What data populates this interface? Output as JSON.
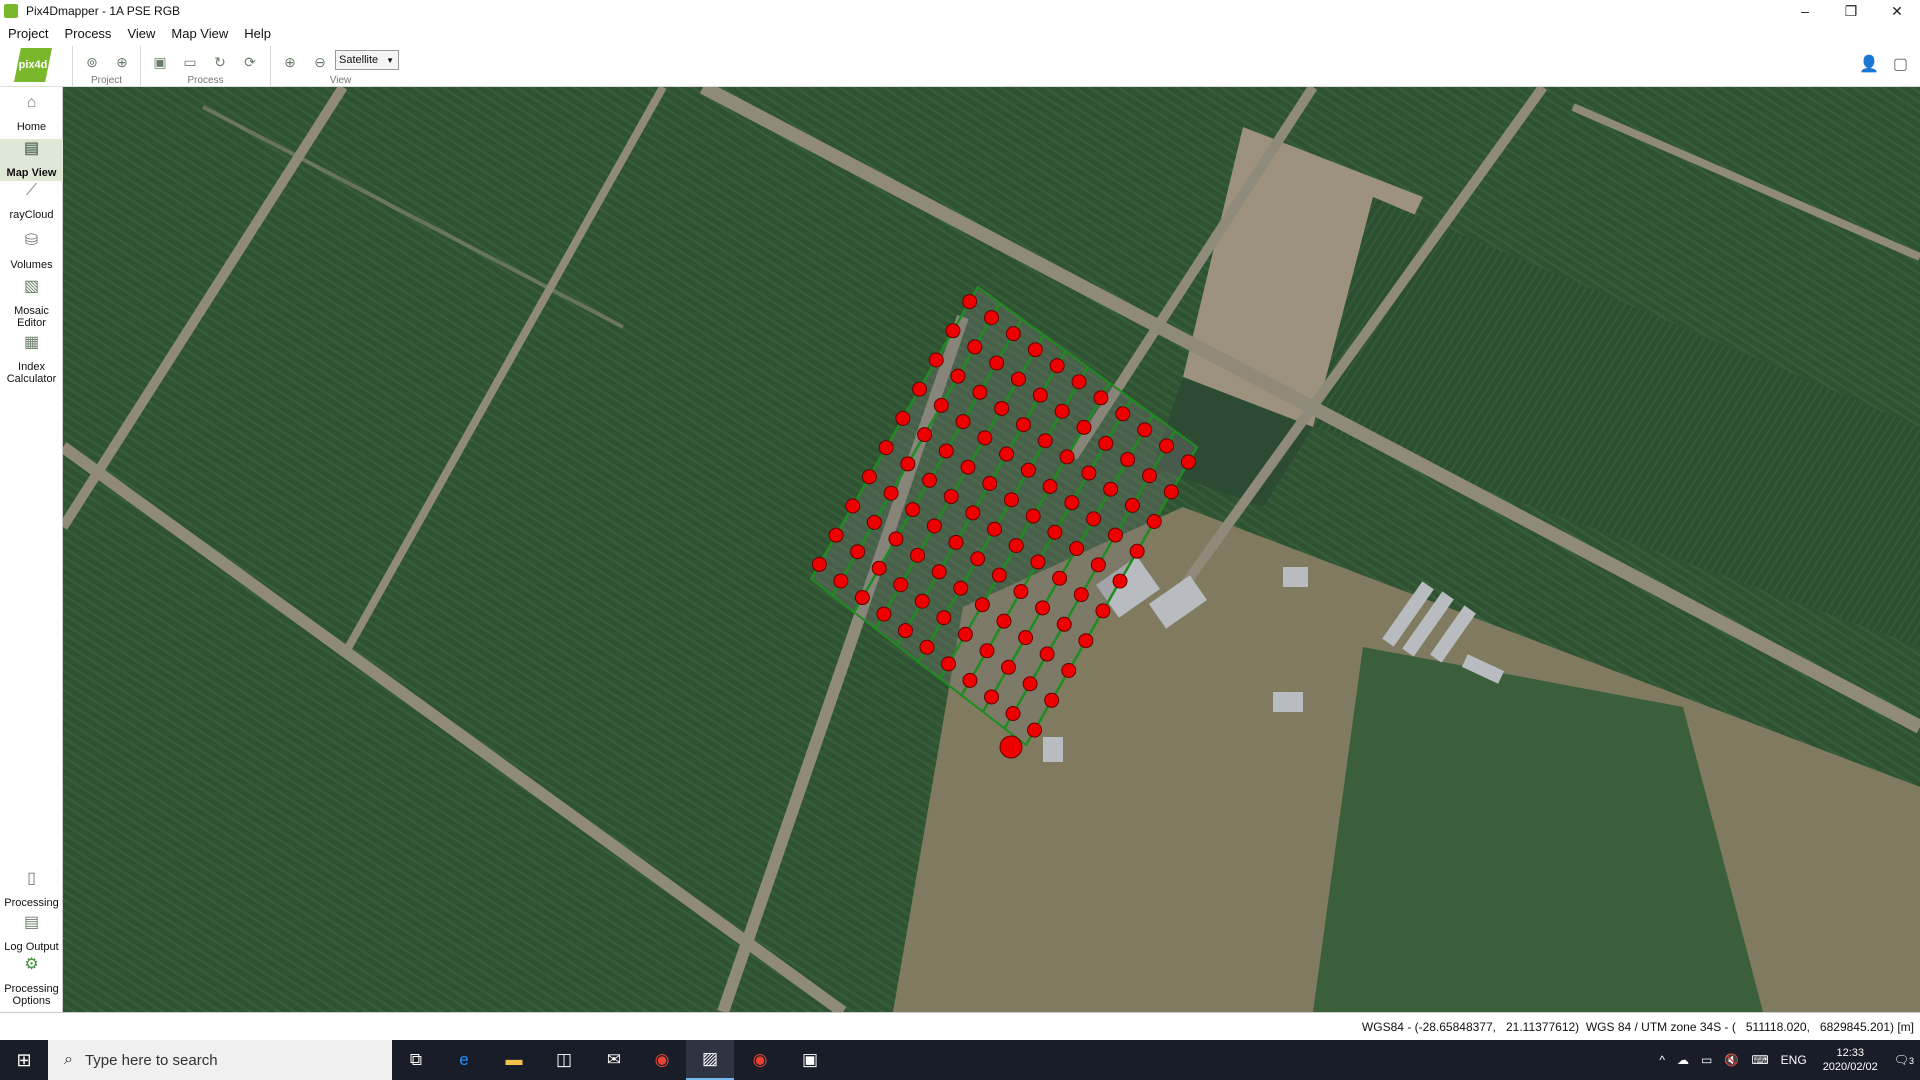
{
  "window": {
    "title": "Pix4Dmapper - 1A PSE RGB",
    "controls": {
      "minimize": "–",
      "restore": "❐",
      "close": "✕"
    }
  },
  "menu": [
    "Project",
    "Process",
    "View",
    "Map View",
    "Help"
  ],
  "toolbar": {
    "logo": "pix4d",
    "groups": {
      "project": "Project",
      "process": "Process",
      "view": "View"
    },
    "basemap": "Satellite"
  },
  "sidebar": {
    "home": "Home",
    "map_view": "Map View",
    "raycloud": "rayCloud",
    "volumes": "Volumes",
    "mosaic_editor": "Mosaic Editor",
    "index_calculator": "Index Calculator",
    "processing": "Processing",
    "log_output": "Log Output",
    "processing_options": "Processing Options"
  },
  "status": {
    "coordinates": "WGS84 - (-28.65848377,   21.11377612)  WGS 84 / UTM zone 34S - (   511118.020,   6829845.201) [m]"
  },
  "taskbar": {
    "search_placeholder": "Type here to search",
    "language": "ENG",
    "time": "12:33",
    "date": "2020/02/02",
    "notification_count": "3"
  },
  "colors": {
    "accent": "#79b82a",
    "flight_point": "#ee0000",
    "flight_line": "#1e8c1e",
    "field_dark": "#2f5232",
    "field_light": "#365c38",
    "road": "#8f8a7a"
  },
  "icons": [
    "home-icon",
    "map-view-icon",
    "raycloud-icon",
    "volumes-icon",
    "mosaic-editor-icon",
    "index-calculator-icon",
    "processing-icon",
    "log-output-icon",
    "gear-icon",
    "zoom-in-icon",
    "zoom-out-icon",
    "search-icon",
    "windows-start-icon"
  ]
}
